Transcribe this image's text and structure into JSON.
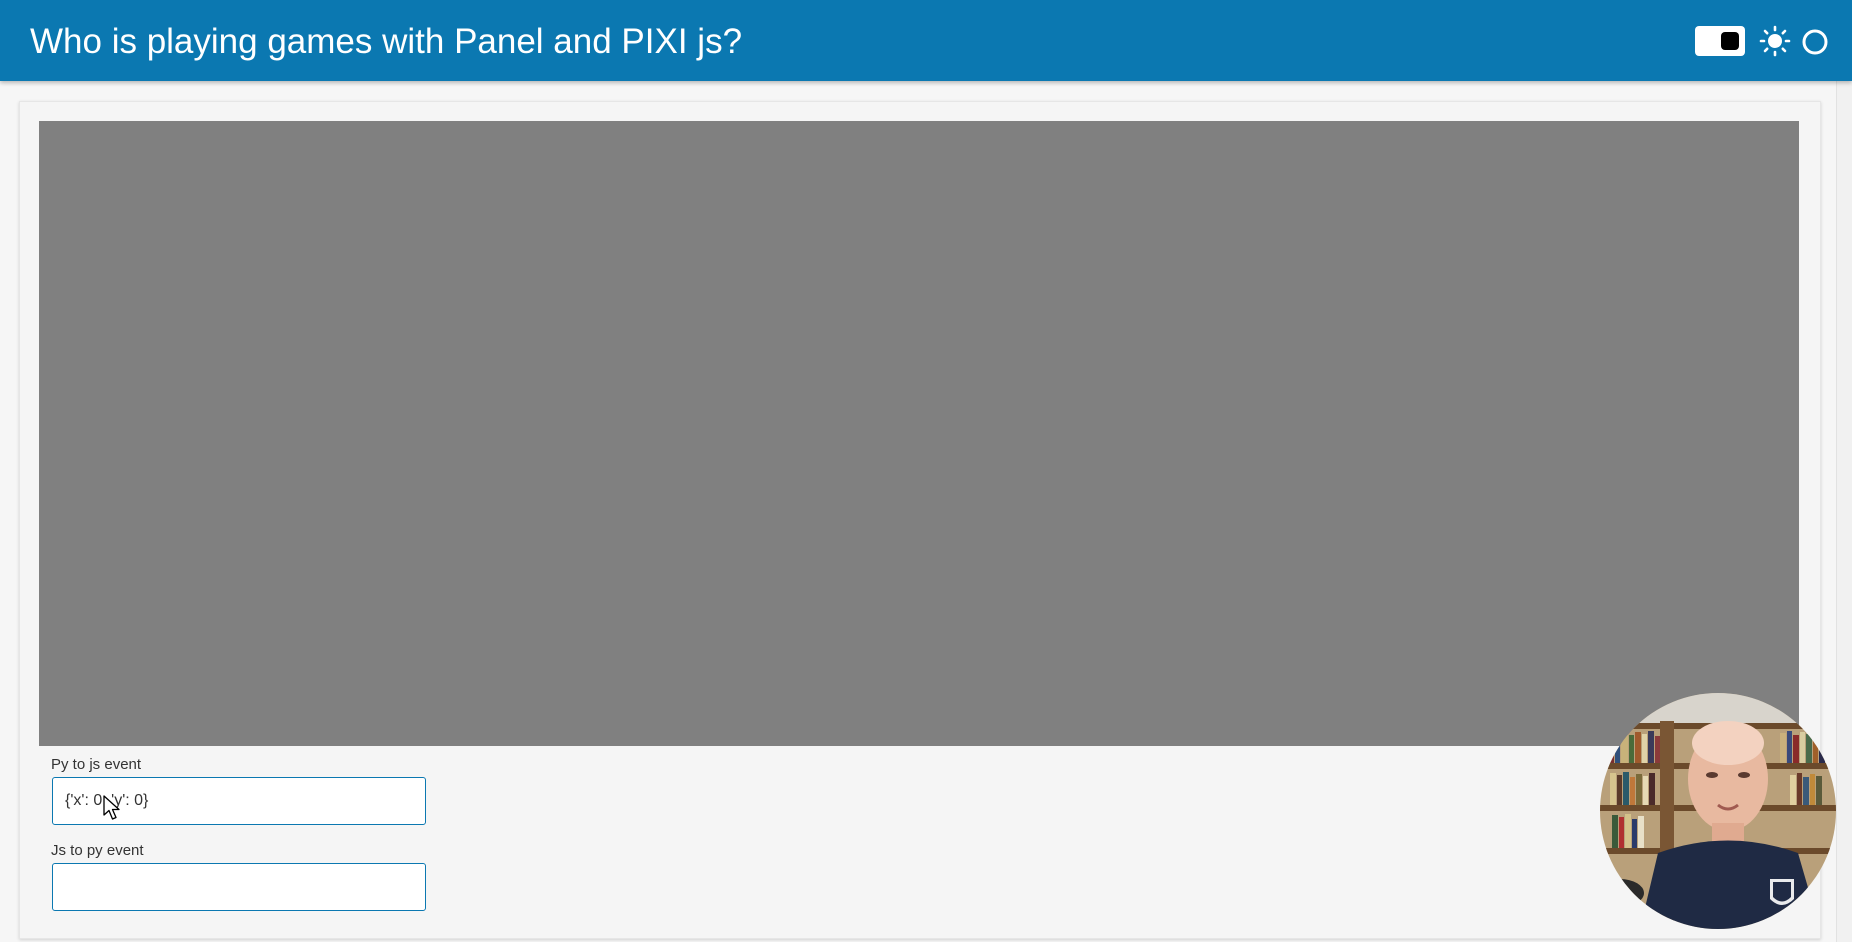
{
  "header": {
    "title": "Who is playing games with Panel and PIXI js?",
    "background_color": "#0b78b1",
    "icons": [
      "theme-toggle-icon",
      "sun-icon",
      "busy-indicator-icon"
    ]
  },
  "canvas": {
    "background_color": "#808080"
  },
  "form": {
    "py_to_js": {
      "label": "Py to js event",
      "value": "{'x': 0, 'y': 0}"
    },
    "js_to_py": {
      "label": "Js to py event",
      "value": ""
    }
  },
  "overlay": {
    "presenter_webcam": "presenter-webcam-avatar"
  }
}
